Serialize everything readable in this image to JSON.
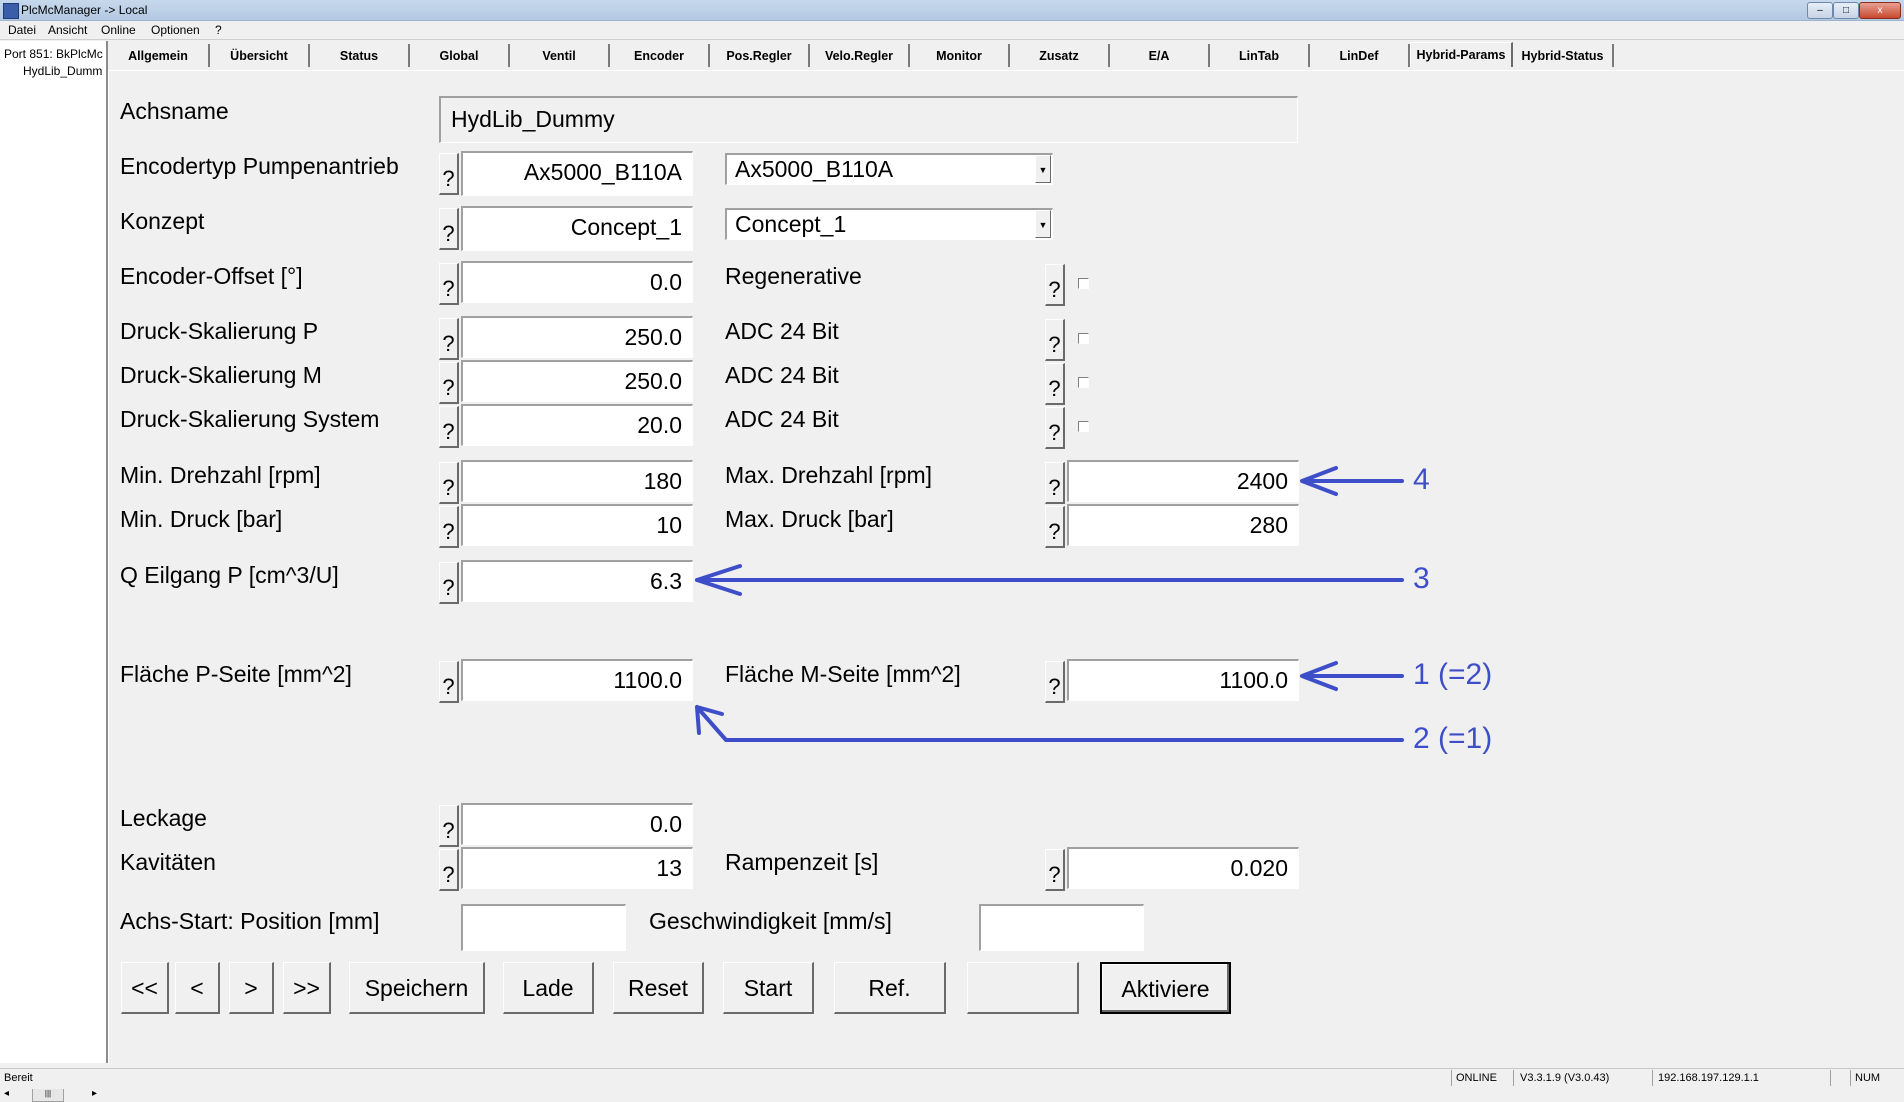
{
  "window": {
    "title": "PlcMcManager -> Local",
    "minimize": "–",
    "maximize": "□",
    "close": "x"
  },
  "menu": [
    "Datei",
    "Ansicht",
    "Online",
    "Optionen",
    "?"
  ],
  "tree": {
    "port": "Port 851: BkPlcMc",
    "axis": "HydLib_Dumm",
    "scroll_left": "◂",
    "scroll_thumb": "|||",
    "scroll_right": "▸"
  },
  "tabs": [
    "Allgemein",
    "Übersicht",
    "Status",
    "Global",
    "Ventil",
    "Encoder",
    "Pos.Regler",
    "Velo.Regler",
    "Monitor",
    "Zusatz",
    "E/A",
    "LinTab",
    "LinDef",
    "Hybrid-Params",
    "Hybrid-Status"
  ],
  "active_tab": "Hybrid-Params",
  "help_label": "?",
  "form": {
    "achsname": {
      "label": "Achsname",
      "value": "HydLib_Dummy"
    },
    "encodertyp": {
      "label": "Encodertyp Pumpenantrieb",
      "value": "Ax5000_B110A",
      "selected": "Ax5000_B110A"
    },
    "konzept": {
      "label": "Konzept",
      "value": "Concept_1",
      "selected": "Concept_1"
    },
    "encoder_offset": {
      "label": "Encoder-Offset [°]",
      "value": "0.0"
    },
    "regenerative": {
      "label": "Regenerative",
      "checked": false
    },
    "druck_p": {
      "label": "Druck-Skalierung P",
      "value": "250.0"
    },
    "druck_m": {
      "label": "Druck-Skalierung M",
      "value": "250.0"
    },
    "druck_sys": {
      "label": "Druck-Skalierung System",
      "value": "20.0"
    },
    "adc1": {
      "label": "ADC 24 Bit",
      "checked": false
    },
    "adc2": {
      "label": "ADC 24 Bit",
      "checked": false
    },
    "adc3": {
      "label": "ADC 24 Bit",
      "checked": false
    },
    "min_drehzahl": {
      "label": "Min. Drehzahl [rpm]",
      "value": "180"
    },
    "max_drehzahl": {
      "label": "Max. Drehzahl [rpm]",
      "value": "2400"
    },
    "min_druck": {
      "label": "Min. Druck [bar]",
      "value": "10"
    },
    "max_druck": {
      "label": "Max. Druck [bar]",
      "value": "280"
    },
    "q_eilgang": {
      "label": "Q Eilgang P [cm^3/U]",
      "value": "6.3"
    },
    "flaeche_p": {
      "label": "Fläche P-Seite [mm^2]",
      "value": "1100.0"
    },
    "flaeche_m": {
      "label": "Fläche M-Seite [mm^2]",
      "value": "1100.0"
    },
    "leckage": {
      "label": "Leckage",
      "value": "0.0"
    },
    "kavitaeten": {
      "label": "Kavitäten",
      "value": "13"
    },
    "rampenzeit": {
      "label": "Rampenzeit [s]",
      "value": "0.020"
    },
    "achs_start": {
      "label": "Achs-Start: Position [mm]",
      "value": ""
    },
    "geschwindigkeit": {
      "label": "Geschwindigkeit [mm/s]",
      "value": ""
    }
  },
  "buttons": {
    "first": "<<",
    "prev": "<",
    "next": ">",
    "last": ">>",
    "save": "Speichern",
    "load": "Lade",
    "reset": "Reset",
    "start": "Start",
    "ref": "Ref.",
    "blank": "",
    "activate": "Aktiviere"
  },
  "annotations": {
    "a4": "4",
    "a3": "3",
    "a1": "1 (=2)",
    "a2": "2 (=1)",
    "color": "#3e4ec9"
  },
  "statusbar": {
    "ready": "Bereit",
    "state": "ONLINE",
    "version": "V3.3.1.9 (V3.0.43)",
    "ip": "192.168.197.129.1.1",
    "num": "NUM"
  }
}
